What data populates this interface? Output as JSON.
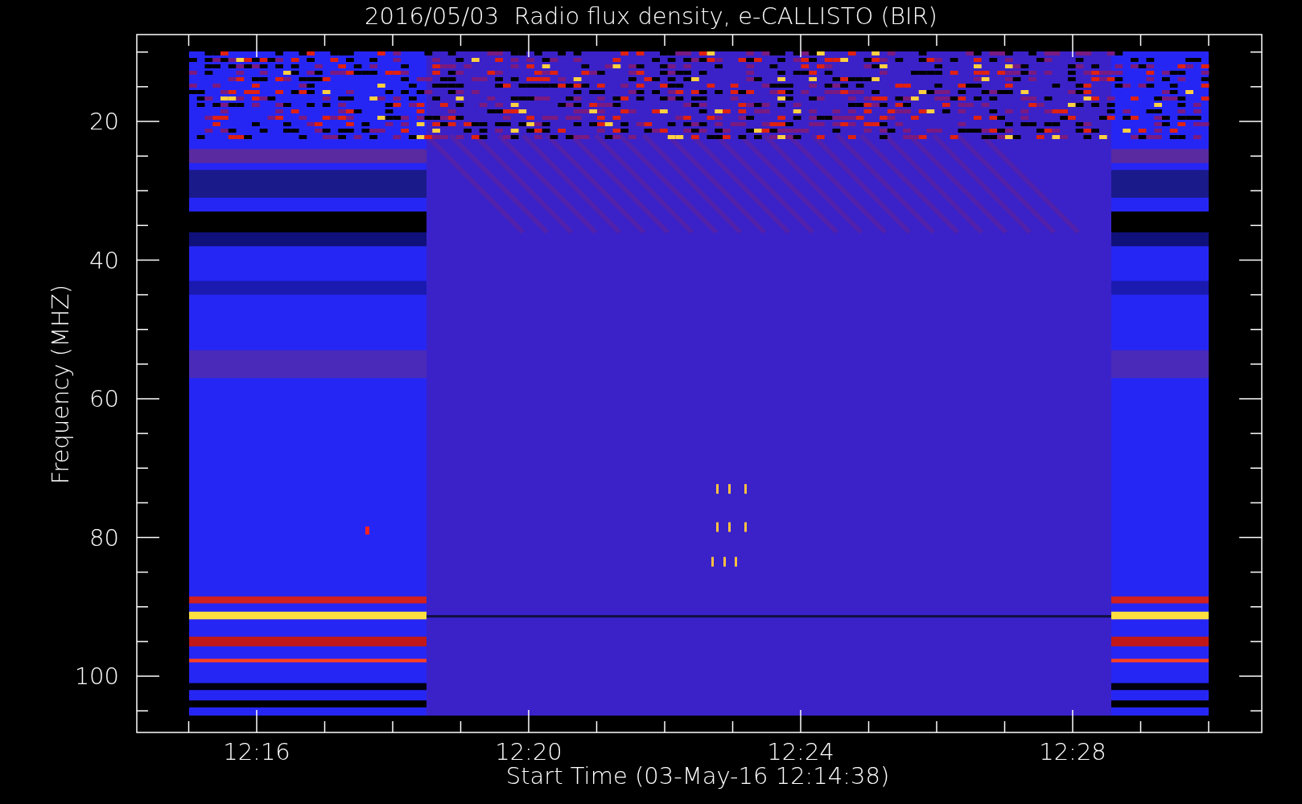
{
  "title": "2016/05/03  Radio flux density, e-CALLISTO (BIR)",
  "ylabel": "Frequency (MHZ)",
  "xlabel": "Start Time (03-May-16 12:14:38)",
  "yticks": [
    "20",
    "40",
    "60",
    "80",
    "100"
  ],
  "xticks": [
    "12:16",
    "12:20",
    "12:24",
    "12:28"
  ]
}
